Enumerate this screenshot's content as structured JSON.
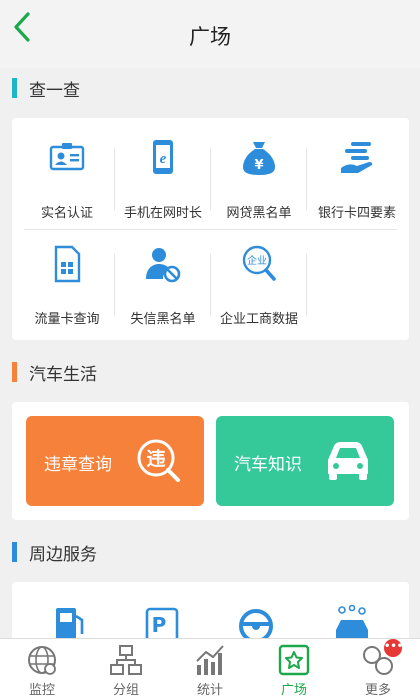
{
  "header": {
    "title": "广场"
  },
  "sections": {
    "check": {
      "title": "查一查",
      "accent": "#1cb6c8"
    },
    "car": {
      "title": "汽车生活",
      "accent": "#f5813a"
    },
    "nearby": {
      "title": "周边服务",
      "accent": "#2e8ddb"
    }
  },
  "check_items": [
    {
      "label": "实名认证",
      "icon": "id-card-icon"
    },
    {
      "label": "手机在网时长",
      "icon": "phone-time-icon"
    },
    {
      "label": "网贷黑名单",
      "icon": "money-bag-icon"
    },
    {
      "label": "银行卡四要素",
      "icon": "bank-card-hand-icon"
    },
    {
      "label": "流量卡查询",
      "icon": "sim-card-icon"
    },
    {
      "label": "失信黑名单",
      "icon": "blocked-user-icon"
    },
    {
      "label": "企业工商数据",
      "icon": "company-search-icon",
      "icon_text": "企业"
    }
  ],
  "car_items": [
    {
      "label": "违章查询",
      "icon_text": "违",
      "color": "#f5813a"
    },
    {
      "label": "汽车知识",
      "color": "#35c99a"
    }
  ],
  "nearby_icons": [
    "gas-station-icon",
    "parking-icon",
    "steering-wheel-icon",
    "car-wash-icon"
  ],
  "tabbar": {
    "items": [
      {
        "label": "监控",
        "icon": "globe-icon"
      },
      {
        "label": "分组",
        "icon": "hierarchy-icon"
      },
      {
        "label": "统计",
        "icon": "bar-chart-icon"
      },
      {
        "label": "广场",
        "icon": "star-square-icon",
        "active": true
      },
      {
        "label": "更多",
        "icon": "circles-icon",
        "badge": "•••"
      }
    ]
  },
  "colors": {
    "green": "#1aa84a",
    "blue": "#2e8ddb"
  }
}
